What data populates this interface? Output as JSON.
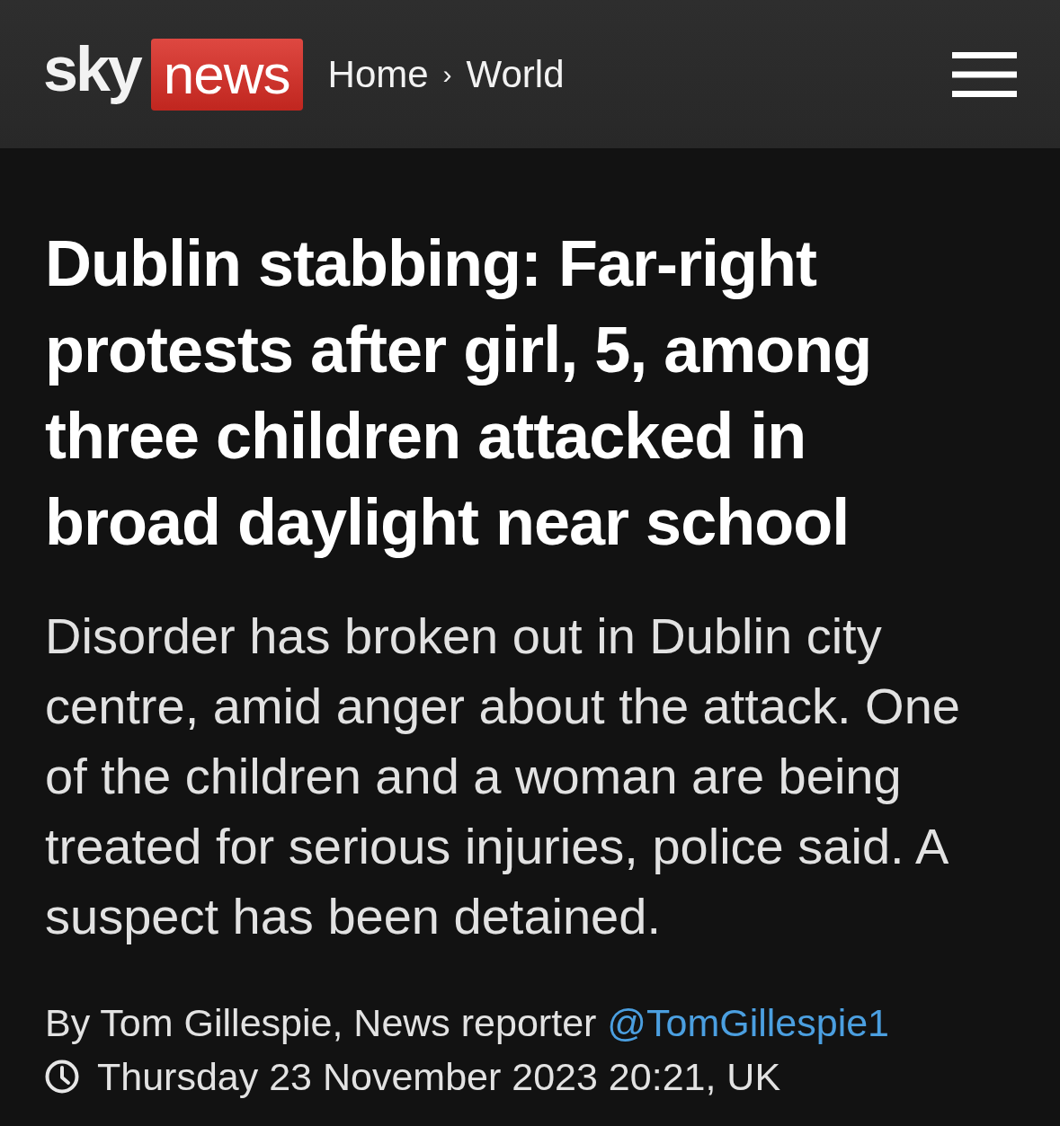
{
  "header": {
    "logo": {
      "sky": "sky",
      "news": "news"
    },
    "breadcrumb": [
      {
        "label": "Home"
      },
      {
        "label": "World"
      }
    ],
    "separator": "›"
  },
  "article": {
    "headline": "Dublin stabbing: Far-right protests after girl, 5, among three children attacked in broad daylight near school",
    "summary": "Disorder has broken out in Dublin city centre, amid anger about the attack. One of the children and a woman are being treated for serious injuries, police said. A suspect has been detained.",
    "byline": {
      "text": "By Tom Gillespie, News reporter",
      "handle": "@TomGillespie1"
    },
    "date": "Thursday 23 November 2023 20:21, UK"
  }
}
